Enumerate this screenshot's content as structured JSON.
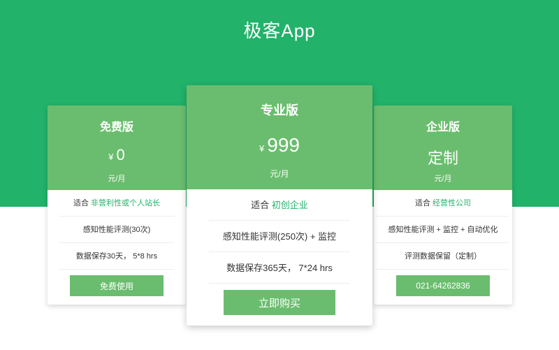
{
  "app": {
    "title": "极客App"
  },
  "colors": {
    "hero_green": "#22b26a",
    "card_green": "#6abd6e",
    "accent_text": "#22b26a"
  },
  "plans": [
    {
      "name": "免费版",
      "currency": "¥",
      "price": "0",
      "unit": "元/月",
      "features": [
        {
          "prefix": "适合 ",
          "accent": "非营利性或个人站长"
        },
        {
          "prefix": "感知性能评测(30次)",
          "accent": ""
        },
        {
          "prefix": "数据保存30天， 5*8 hrs",
          "accent": ""
        }
      ],
      "cta": "免费使用"
    },
    {
      "name": "专业版",
      "currency": "¥",
      "price": "999",
      "unit": "元/月",
      "features": [
        {
          "prefix": "适合 ",
          "accent": "初创企业"
        },
        {
          "prefix": "感知性能评测(250次) + 监控",
          "accent": ""
        },
        {
          "prefix": "数据保存365天， 7*24 hrs",
          "accent": ""
        }
      ],
      "cta": "立即购买"
    },
    {
      "name": "企业版",
      "currency": "",
      "price": "定制",
      "unit": "元/月",
      "features": [
        {
          "prefix": "适合 ",
          "accent": "经营性公司"
        },
        {
          "prefix": "感知性能评测 + 监控 + 自动优化",
          "accent": ""
        },
        {
          "prefix": "评测数据保留（定制）",
          "accent": ""
        }
      ],
      "cta": "021-64262836"
    }
  ]
}
